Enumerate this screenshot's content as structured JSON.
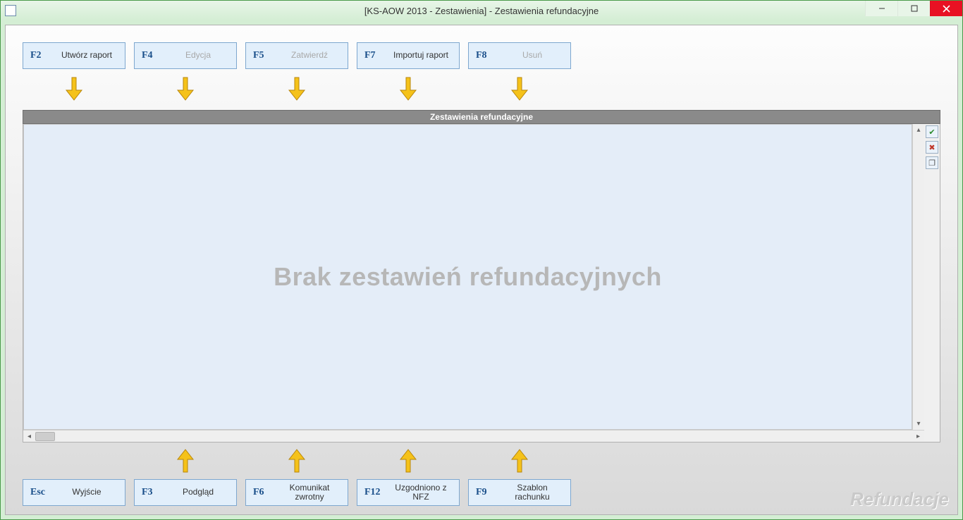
{
  "window": {
    "title": "[KS-AOW 2013 - Zestawienia] - Zestawienia refundacyjne"
  },
  "topButtons": [
    {
      "key": "F2",
      "label": "Utwórz raport",
      "enabled": true
    },
    {
      "key": "F4",
      "label": "Edycja",
      "enabled": false
    },
    {
      "key": "F5",
      "label": "Zatwierdź",
      "enabled": false
    },
    {
      "key": "F7",
      "label": "Importuj raport",
      "enabled": true
    },
    {
      "key": "F8",
      "label": "Usuń",
      "enabled": false
    }
  ],
  "panel": {
    "header": "Zestawienia refundacyjne",
    "emptyMessage": "Brak zestawień refundacyjnych"
  },
  "bottomButtons": [
    {
      "key": "Esc",
      "label": "Wyjście",
      "enabled": true
    },
    {
      "key": "F3",
      "label": "Podgląd",
      "enabled": true
    },
    {
      "key": "F6",
      "label": "Komunikat zwrotny",
      "enabled": true
    },
    {
      "key": "F12",
      "label": "Uzgodniono z NFZ",
      "enabled": true
    },
    {
      "key": "F9",
      "label": "Szablon rachunku",
      "enabled": true
    }
  ],
  "footer": {
    "label": "Refundacje"
  },
  "sideIcons": [
    {
      "name": "filter-apply-icon"
    },
    {
      "name": "filter-clear-icon"
    },
    {
      "name": "columns-icon"
    }
  ]
}
